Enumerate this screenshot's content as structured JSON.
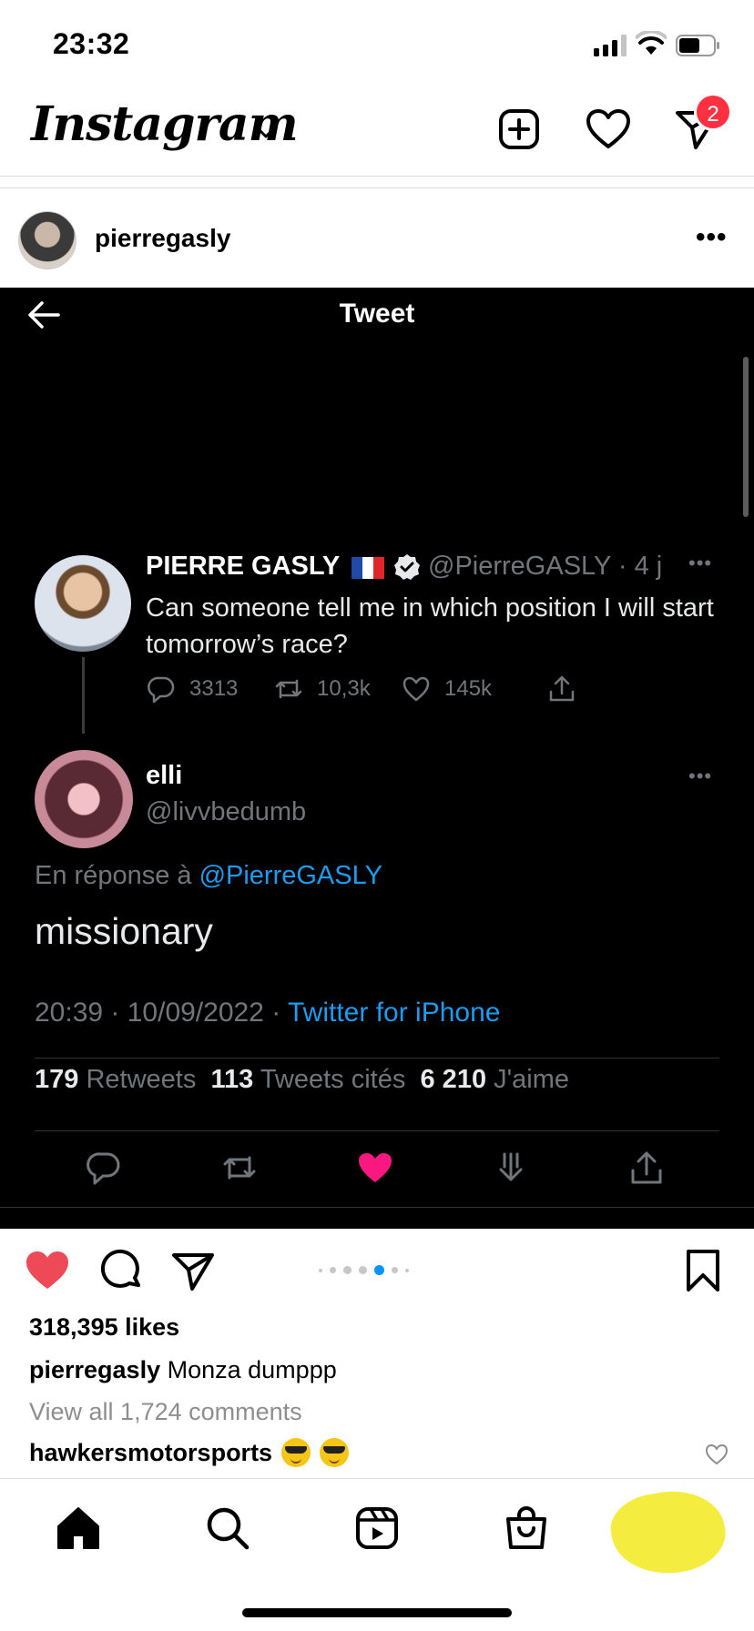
{
  "status_bar": {
    "time": "23:32"
  },
  "header": {
    "app_name": "Instagram",
    "dm_badge": "2"
  },
  "post": {
    "username": "pierregasly",
    "more_label": "•••",
    "likes": "318,395 likes",
    "caption_user": "pierregasly",
    "caption_text": "Monza dumppp",
    "view_comments": "View all 1,724 comments",
    "comment_user": "hawkersmotorsports",
    "carousel": {
      "count": 7,
      "active_index": 4
    }
  },
  "tweet": {
    "screen_title": "Tweet",
    "original": {
      "name": "PIERRE GASLY",
      "handle": "@PierreGASLY · 4 j",
      "text": "Can someone tell me in which position I will start tomorrow’s race?",
      "replies": "3313",
      "retweets": "10,3k",
      "likes": "145k",
      "more": "•••"
    },
    "reply": {
      "name": "elli",
      "handle": "@livvbedumb",
      "reply_to_prefix": "En réponse à",
      "reply_to_handle": "@PierreGASLY",
      "text": "missionary",
      "timestamp": "20:39 · 10/09/2022 ·",
      "source": "Twitter for iPhone",
      "more": "•••"
    },
    "stats": {
      "retweets_count": "179",
      "retweets_label": "Retweets",
      "quotes_count": "113",
      "quotes_label": "Tweets cités",
      "likes_count": "6 210",
      "likes_label": "J'aime"
    }
  },
  "colors": {
    "badge": "#ff3040",
    "like_red": "#ed4956",
    "tw_link": "#1d9bf0",
    "tw_like_pink": "#f91880",
    "carousel_active": "#0095f6"
  }
}
